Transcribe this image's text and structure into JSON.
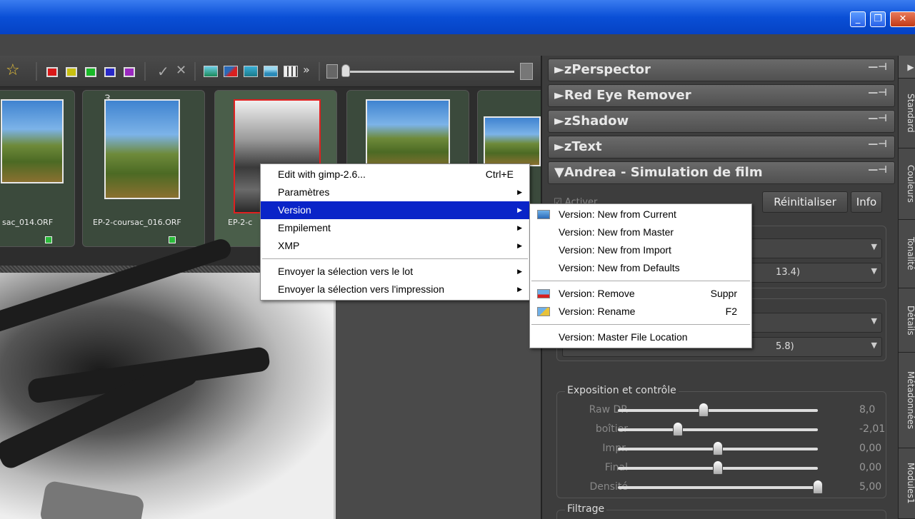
{
  "window": {
    "minimize": "_",
    "maximize": "❐",
    "close": "✕"
  },
  "toolbar": {
    "star": "☆",
    "check": "✓",
    "cross": "✕",
    "more": "»"
  },
  "thumbnails": [
    {
      "label": "sac_014.ORF",
      "number": ""
    },
    {
      "label": "EP-2-coursac_016.ORF",
      "number": "3"
    },
    {
      "label": "EP-2-c",
      "number": ""
    },
    {
      "label": "",
      "number": ""
    },
    {
      "label": "",
      "number": ""
    }
  ],
  "panels": {
    "items": [
      "►zPerspector",
      "►Red Eye Remover",
      "►zShadow",
      "►zText",
      "▼Andrea - Simulation de film"
    ],
    "pin": "—⊣",
    "activer": "☑ Activer",
    "reset_btn": "Réinitialiser",
    "info_btn": "Info",
    "dd1": "",
    "dd2": "13.4)",
    "dd3": "",
    "dd4": "5.8)",
    "exposure_group": "Exposition et contrôle",
    "filtrage_group": "Filtrage",
    "sliders": [
      {
        "label": "Raw DR",
        "value": "8,0",
        "pos": 0.43
      },
      {
        "label": "boîtier",
        "value": "-2,01",
        "pos": 0.3
      },
      {
        "label": "Impr.",
        "value": "0,00",
        "pos": 0.5
      },
      {
        "label": "Final",
        "value": "0,00",
        "pos": 0.5
      },
      {
        "label": "Densité",
        "value": "5,00",
        "pos": 1.0
      }
    ]
  },
  "sidetabs": [
    "Standard",
    "Couleurs",
    "Tonalité",
    "Détails",
    "Métadonnées",
    "Modules1"
  ],
  "context_menu": {
    "items": [
      {
        "label": "Edit with gimp-2.6...",
        "shortcut": "Ctrl+E",
        "sub": ""
      },
      {
        "label": "Paramètres",
        "shortcut": "",
        "sub": "▶"
      },
      {
        "label": "Version",
        "shortcut": "",
        "sub": "▶"
      },
      {
        "label": "Empilement",
        "shortcut": "",
        "sub": "▶"
      },
      {
        "label": "XMP",
        "shortcut": "",
        "sub": "▶"
      },
      {
        "label": "Envoyer la sélection vers le lot",
        "shortcut": "",
        "sub": "▶"
      },
      {
        "label": "Envoyer la sélection vers l'impression",
        "shortcut": "",
        "sub": "▶"
      }
    ]
  },
  "version_menu": {
    "items": [
      {
        "label": "Version: New from Current",
        "shortcut": ""
      },
      {
        "label": "Version: New from Master",
        "shortcut": ""
      },
      {
        "label": "Version: New from Import",
        "shortcut": ""
      },
      {
        "label": "Version: New from Defaults",
        "shortcut": ""
      },
      {
        "label": "Version: Remove",
        "shortcut": "Suppr"
      },
      {
        "label": "Version: Rename",
        "shortcut": "F2"
      },
      {
        "label": "Version: Master File Location",
        "shortcut": ""
      }
    ]
  },
  "colors": {
    "red": "#d81818",
    "yellow": "#c8c010",
    "green": "#18b828",
    "blue": "#2828c8",
    "purple": "#9a28c0",
    "menu_highlight": "#0a24c8"
  }
}
